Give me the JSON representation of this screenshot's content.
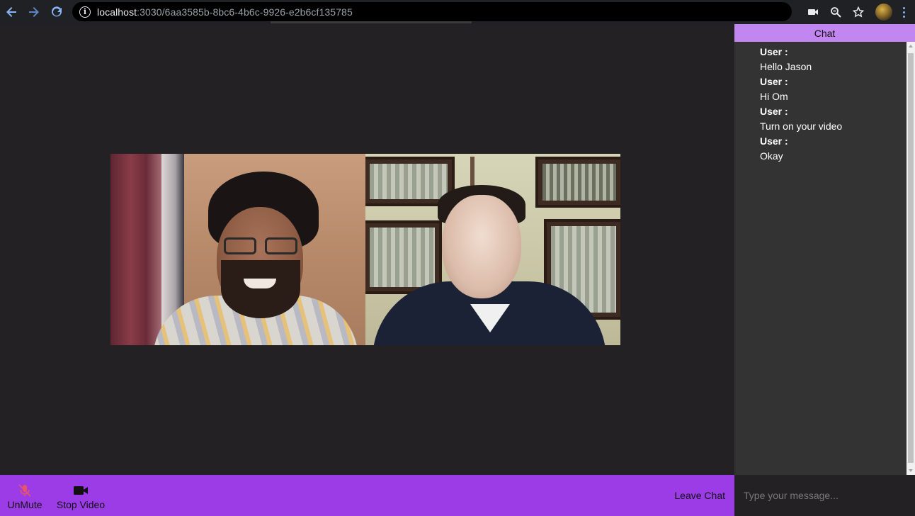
{
  "browser": {
    "url_host": "localhost",
    "url_path": ":3030/6aa3585b-8bc6-4b6c-9926-e2b6cf135785",
    "icons": [
      "back-icon",
      "forward-icon",
      "reload-icon",
      "info-icon",
      "camera-icon",
      "zoom-icon",
      "star-icon",
      "profile-avatar",
      "menu-icon"
    ]
  },
  "controls": {
    "mute_label": "UnMute",
    "video_label": "Stop Video",
    "leave_label": "Leave Chat",
    "mute_icon": "mic-off-icon",
    "video_icon": "video-camera-icon"
  },
  "chat": {
    "title": "Chat",
    "messages": [
      {
        "user": "User :",
        "text": "Hello Jason"
      },
      {
        "user": "User :",
        "text": "Hi Om"
      },
      {
        "user": "User :",
        "text": "Turn on your video"
      },
      {
        "user": "User :",
        "text": "Okay"
      }
    ],
    "input_placeholder": "Type your message..."
  },
  "colors": {
    "accent": "#9c3ce6",
    "chat_header": "#c286f0",
    "mute_icon": "#e8546a"
  }
}
